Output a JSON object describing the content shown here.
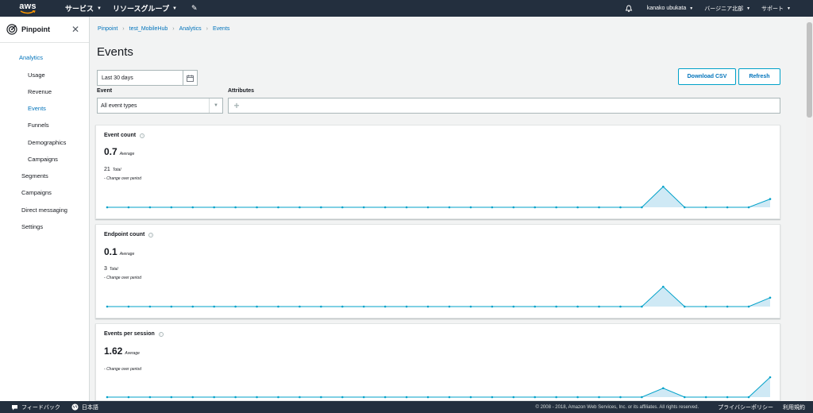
{
  "topnav": {
    "logo_text": "aws",
    "services_label": "サービス",
    "resource_groups_label": "リソースグループ",
    "user_label": "kanako ubukata",
    "region_label": "バージニア北部",
    "support_label": "サポート"
  },
  "sidebar": {
    "title": "Pinpoint",
    "items": [
      {
        "label": "Analytics",
        "active": true
      },
      {
        "label": "Usage"
      },
      {
        "label": "Revenue"
      },
      {
        "label": "Events",
        "active": true
      },
      {
        "label": "Funnels"
      },
      {
        "label": "Demographics"
      },
      {
        "label": "Campaigns"
      },
      {
        "label": "Segments"
      },
      {
        "label": "Campaigns"
      },
      {
        "label": "Direct messaging"
      },
      {
        "label": "Settings"
      }
    ]
  },
  "breadcrumb": [
    "Pinpoint",
    "test_MobileHub",
    "Analytics",
    "Events"
  ],
  "page_title": "Events",
  "filters": {
    "date_range": "Last 30 days",
    "event_label": "Event",
    "event_value": "All event types",
    "attributes_label": "Attributes"
  },
  "buttons": {
    "download_csv": "Download CSV",
    "refresh": "Refresh"
  },
  "cards": [
    {
      "title": "Event count",
      "value": "0.7",
      "value_note": "Average",
      "total": "21",
      "total_note": "Total",
      "change_note": "Change over period"
    },
    {
      "title": "Endpoint count",
      "value": "0.1",
      "value_note": "Average",
      "total": "3",
      "total_note": "Total",
      "change_note": "Change over period"
    },
    {
      "title": "Events per session",
      "value": "1.62",
      "value_note": "Average",
      "change_note": "Change over period"
    }
  ],
  "chart_data": [
    {
      "type": "area",
      "series": [
        {
          "values": [
            0,
            0,
            0,
            0,
            0,
            0,
            0,
            0,
            0,
            0,
            0,
            0,
            0,
            0,
            0,
            0,
            0,
            0,
            0,
            0,
            0,
            0,
            0,
            0,
            0,
            0,
            1,
            0,
            0,
            0,
            0,
            0.4
          ]
        }
      ]
    },
    {
      "type": "area",
      "series": [
        {
          "values": [
            0,
            0,
            0,
            0,
            0,
            0,
            0,
            0,
            0,
            0,
            0,
            0,
            0,
            0,
            0,
            0,
            0,
            0,
            0,
            0,
            0,
            0,
            0,
            0,
            0,
            0,
            1,
            0,
            0,
            0,
            0,
            0.45
          ]
        }
      ]
    },
    {
      "type": "area",
      "series": [
        {
          "values": [
            0,
            0,
            0,
            0,
            0,
            0,
            0,
            0,
            0,
            0,
            0,
            0,
            0,
            0,
            0,
            0,
            0,
            0,
            0,
            0,
            0,
            0,
            0,
            0,
            0,
            0,
            0.45,
            0,
            0,
            0,
            0,
            1
          ]
        }
      ]
    }
  ],
  "colors": {
    "nav_bg": "#232f3e",
    "accent": "#0073bb",
    "chart_line": "#00a1c9",
    "chart_fill": "#cfe9f5"
  },
  "footer": {
    "feedback_label": "フィードバック",
    "language_label": "日本語",
    "copyright": "© 2008 - 2018, Amazon Web Services, Inc. or its affiliates. All rights reserved.",
    "privacy_label": "プライバシーポリシー",
    "terms_label": "利用規約"
  }
}
